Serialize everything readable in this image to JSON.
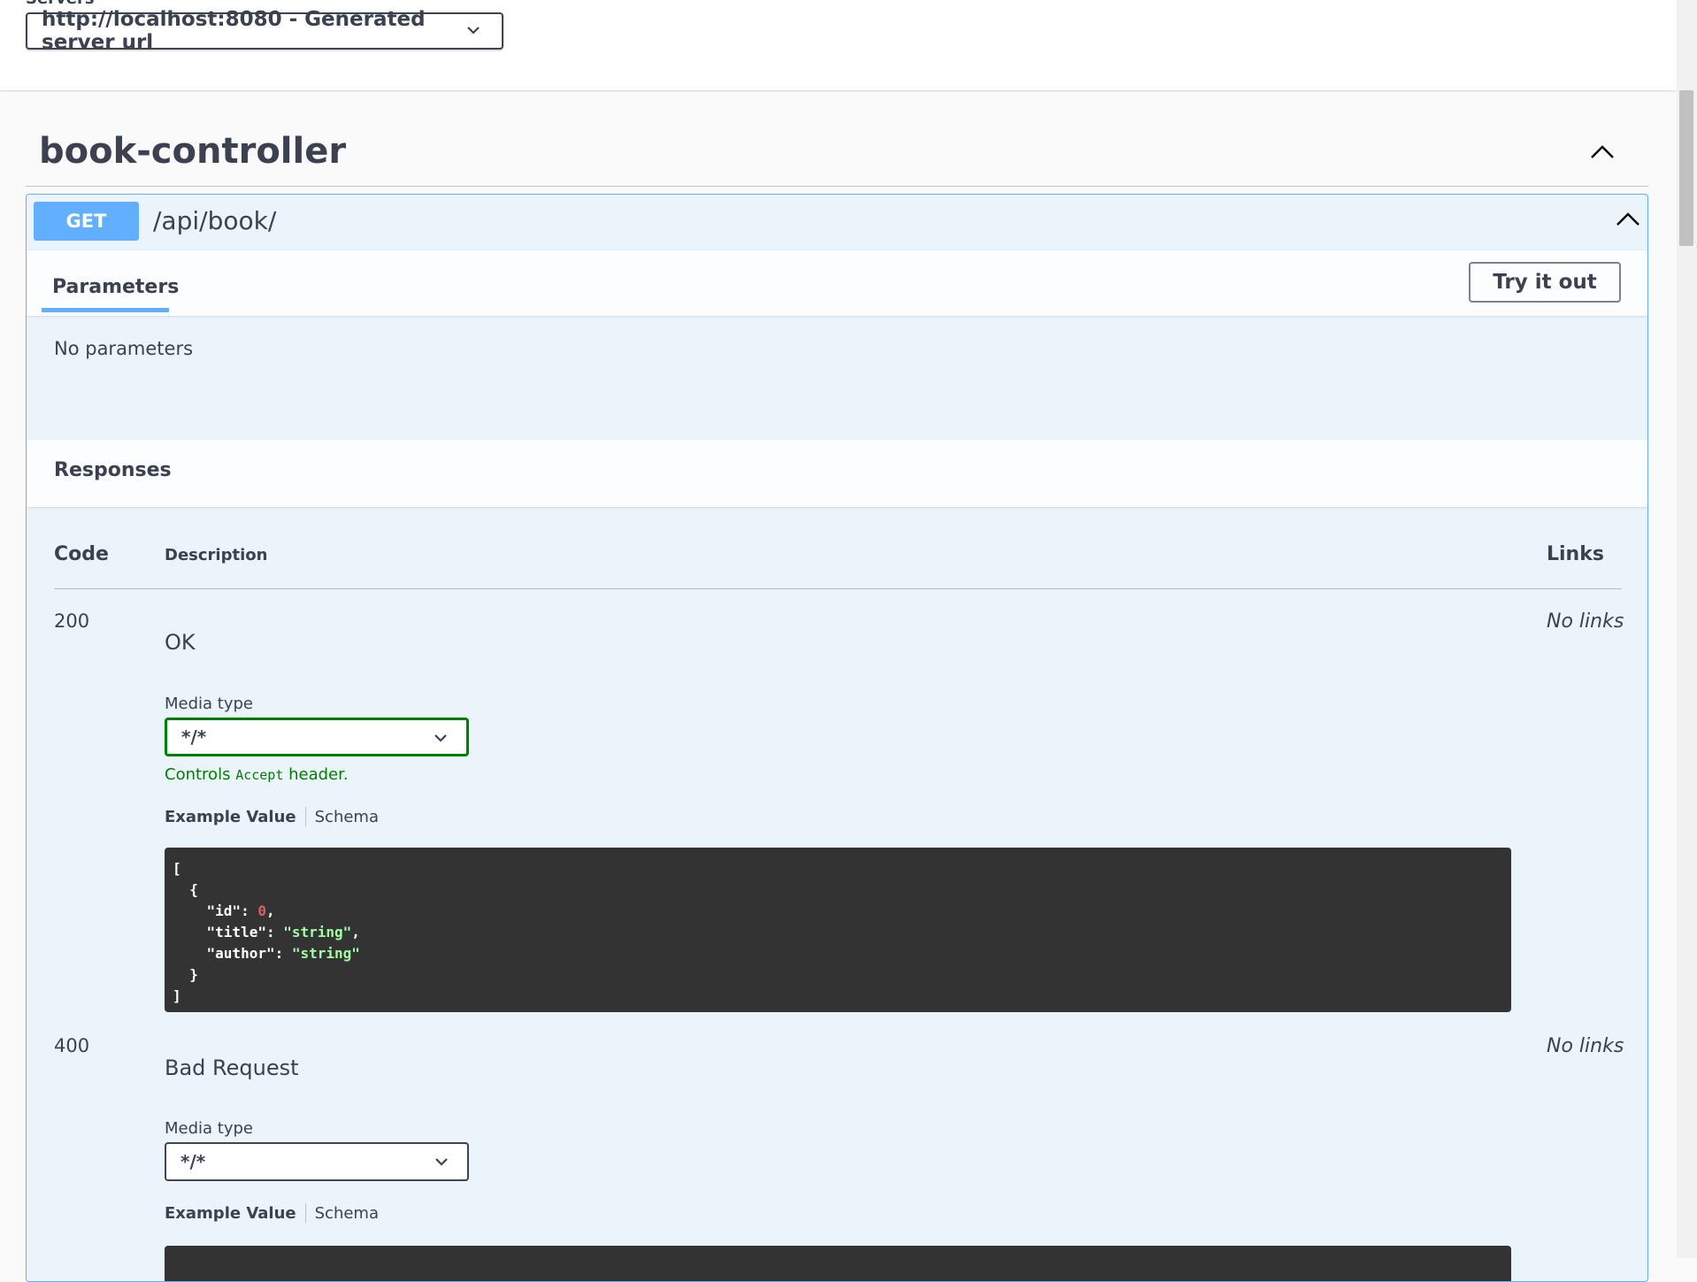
{
  "servers": {
    "label": "Servers",
    "selected": "http://localhost:8080 - Generated server url"
  },
  "tag": {
    "title": "book-controller"
  },
  "operation": {
    "method": "GET",
    "path": "/api/book/",
    "parameters_tab": "Parameters",
    "try_it_out": "Try it out",
    "no_parameters": "No parameters",
    "responses_title": "Responses",
    "columns": {
      "code": "Code",
      "description": "Description",
      "links": "Links"
    },
    "responses": [
      {
        "code": "200",
        "description": "OK",
        "links": "No links",
        "media_type_label": "Media type",
        "media_type": "*/*",
        "controls_prefix": "Controls",
        "controls_code": "Accept",
        "controls_suffix": "header.",
        "example_tab": "Example Value",
        "schema_tab": "Schema",
        "example": {
          "open_bracket": "[",
          "open_brace": "{",
          "id_key": "\"id\"",
          "id_value": "0",
          "title_key": "\"title\"",
          "title_value": "\"string\"",
          "author_key": "\"author\"",
          "author_value": "\"string\"",
          "close_brace": "}",
          "close_bracket": "]"
        }
      },
      {
        "code": "400",
        "description": "Bad Request",
        "links": "No links",
        "media_type_label": "Media type",
        "media_type": "*/*",
        "example_tab": "Example Value",
        "schema_tab": "Schema"
      }
    ]
  },
  "colors": {
    "get_accent": "#61affe",
    "get_background": "#ebf3fb",
    "text": "#3b4151",
    "valid_green": "#008000",
    "code_background": "#333333"
  }
}
